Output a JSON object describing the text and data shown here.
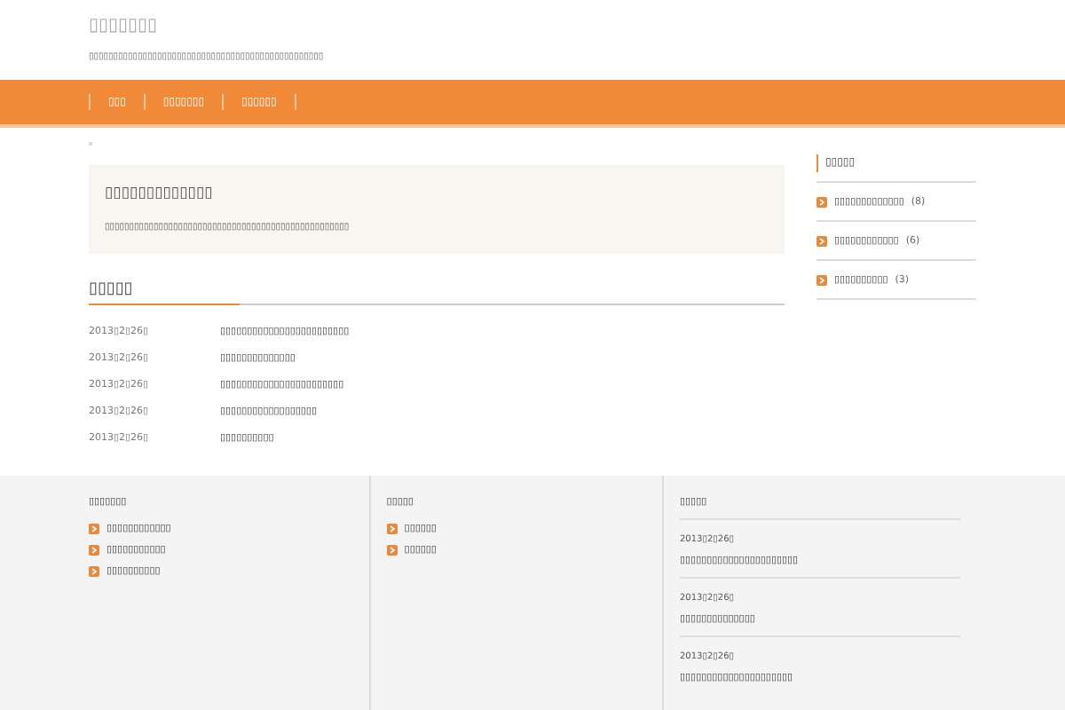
{
  "header": {
    "site_title": "▯▯▯▯▯▯▯",
    "tagline": "▯▯▯▯▯▯▯▯▯▯▯▯▯▯▯▯▯▯▯▯▯▯▯▯▯▯▯▯▯▯▯▯▯▯▯▯▯▯▯▯▯▯▯▯▯▯▯▯"
  },
  "nav": [
    "▯▯▯",
    "▯▯▯▯▯▯▯",
    "▯▯▯▯▯▯"
  ],
  "notice": {
    "title": "▯▯▯▯▯▯▯▯▯▯▯▯▯",
    "text": "▯▯▯▯▯▯▯▯▯▯▯▯▯▯▯▯▯▯▯▯▯▯▯▯▯▯▯▯▯▯▯▯▯▯▯▯▯▯▯▯▯▯▯▯▯▯▯▯▯▯"
  },
  "posts": {
    "heading": "▯▯▯▯▯",
    "items": [
      {
        "date": "2013▯2▯26▯",
        "title": "▯▯▯▯▯▯▯▯▯▯▯▯▯▯▯▯▯▯▯▯▯▯▯▯"
      },
      {
        "date": "2013▯2▯26▯",
        "title": "▯▯▯▯▯▯▯▯▯▯▯▯▯▯"
      },
      {
        "date": "2013▯2▯26▯",
        "title": "▯▯▯▯▯▯▯▯▯▯▯▯▯▯▯▯▯▯▯▯▯▯▯"
      },
      {
        "date": "2013▯2▯26▯",
        "title": "▯▯▯▯▯▯▯▯▯▯▯▯▯▯▯▯▯▯"
      },
      {
        "date": "2013▯2▯26▯",
        "title": "▯▯▯▯▯▯▯▯▯▯"
      }
    ]
  },
  "sidebar": {
    "heading": "▯▯▯▯▯",
    "items": [
      {
        "label": "▯▯▯▯▯▯▯▯▯▯▯▯▯",
        "count": "(8)"
      },
      {
        "label": "▯▯▯▯▯▯▯▯▯▯▯▯",
        "count": "(6)"
      },
      {
        "label": "▯▯▯▯▯▯▯▯▯▯",
        "count": "(3)"
      }
    ]
  },
  "footer": {
    "columns": [
      {
        "kind": "links",
        "heading": "▯▯▯▯▯▯▯",
        "items": [
          "▯▯▯▯▯▯▯▯▯▯▯▯",
          "▯▯▯▯▯▯▯▯▯▯▯",
          "▯▯▯▯▯▯▯▯▯▯"
        ]
      },
      {
        "kind": "links",
        "heading": "▯▯▯▯▯",
        "items": [
          "▯▯▯▯▯▯",
          "▯▯▯▯▯▯"
        ]
      },
      {
        "kind": "posts",
        "heading": "▯▯▯▯▯",
        "items": [
          {
            "date": "2013▯2▯26▯",
            "title": "▯▯▯▯▯▯▯▯▯▯▯▯▯▯▯▯▯▯▯▯▯▯"
          },
          {
            "date": "2013▯2▯26▯",
            "title": "▯▯▯▯▯▯▯▯▯▯▯▯▯▯"
          },
          {
            "date": "2013▯2▯26▯",
            "title": "▯▯▯▯▯▯▯▯▯▯▯▯▯▯▯▯▯▯▯▯▯"
          }
        ]
      }
    ]
  }
}
